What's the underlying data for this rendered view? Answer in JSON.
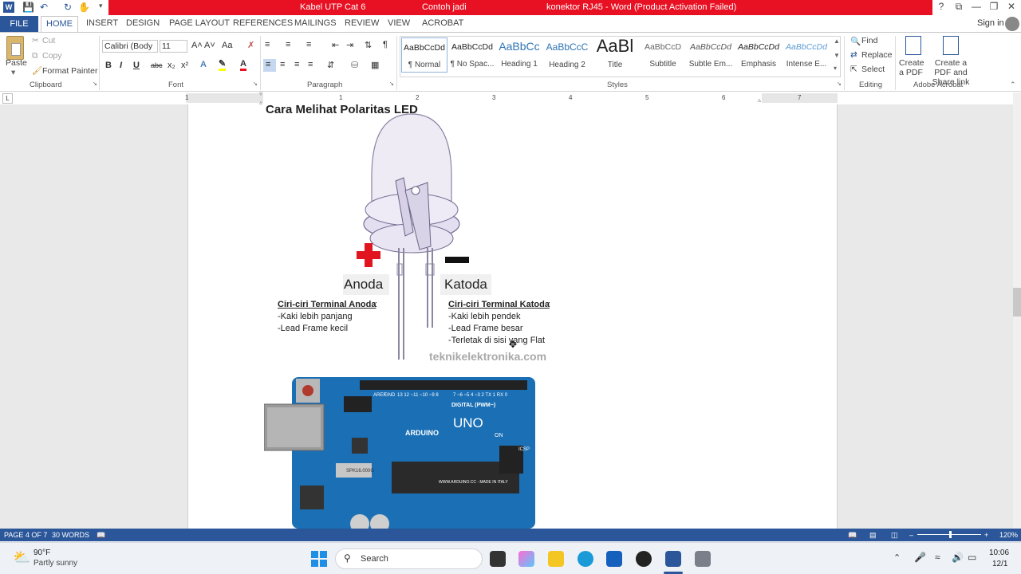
{
  "titlebar": {
    "doc_left": "Kabel UTP Cat 6",
    "doc_mid": "Contoh jadi",
    "doc_title": "konektor RJ45 -  Word (Product Activation Failed)",
    "help": "?",
    "sign_in": "Sign in"
  },
  "tabs": [
    "FILE",
    "HOME",
    "INSERT",
    "DESIGN",
    "PAGE LAYOUT",
    "REFERENCES",
    "MAILINGS",
    "REVIEW",
    "VIEW",
    "ACROBAT"
  ],
  "clipboard": {
    "paste": "Paste",
    "cut": "Cut",
    "copy": "Copy",
    "format_painter": "Format Painter",
    "label": "Clipboard"
  },
  "font": {
    "name": "Calibri (Body",
    "size": "11",
    "label": "Font",
    "grow": "A˄",
    "shrink": "A˅",
    "case": "Aa",
    "bold": "B",
    "italic": "I",
    "underline": "U",
    "strike": "abc",
    "sub": "x₂",
    "sup": "x²"
  },
  "paragraph": {
    "label": "Paragraph"
  },
  "styles": {
    "label": "Styles",
    "items": [
      {
        "sample": "AaBbCcDd",
        "name": "¶ Normal"
      },
      {
        "sample": "AaBbCcDd",
        "name": "¶ No Spac..."
      },
      {
        "sample": "AaBbCc",
        "name": "Heading 1"
      },
      {
        "sample": "AaBbCcC",
        "name": "Heading 2"
      },
      {
        "sample": "AaBl",
        "name": "Title"
      },
      {
        "sample": "AaBbCcD",
        "name": "Subtitle"
      },
      {
        "sample": "AaBbCcDd",
        "name": "Subtle Em..."
      },
      {
        "sample": "AaBbCcDd",
        "name": "Emphasis"
      },
      {
        "sample": "AaBbCcDd",
        "name": "Intense E..."
      }
    ]
  },
  "editing": {
    "find": "Find",
    "replace": "Replace",
    "select": "Select",
    "label": "Editing"
  },
  "acrobat": {
    "create_pdf": "Create a PDF",
    "create_share": "Create a PDF and Share link",
    "label": "Adobe Acrobat"
  },
  "ruler": {
    "numbers": [
      "1",
      "1",
      "2",
      "3",
      "4",
      "5",
      "6",
      "7"
    ],
    "corner": "L"
  },
  "document": {
    "heading": "Cara Melihat Polaritas LED",
    "anoda": "Anoda",
    "katoda": "Katoda",
    "anoda_title": "Ciri-ciri Terminal Anoda",
    "anoda_colon": ":",
    "anoda_items": [
      "-Kaki lebih panjang",
      "-Lead Frame kecil"
    ],
    "katoda_title": "Ciri-ciri Terminal Katoda",
    "katoda_colon": ":",
    "katoda_items": [
      "-Kaki lebih pendek",
      "-Lead Frame besar",
      "-Terletak di sisi yang Flat"
    ],
    "watermark": "teknikelektronika.com",
    "board_brand": "ARDUINO",
    "board_model": "UNO",
    "board_digital": "DIGITAL (PWM~)",
    "board_site": "WWW.ARDUINO.CC - MADE IN ITALY",
    "board_crystal": "SPK16.000G",
    "board_on": "ON",
    "board_aref": "AREF",
    "board_gnd": "GND",
    "board_pins": "13 12 ~11 ~10 ~9 8",
    "board_pins2": "7 ~6 ~5 4 ~3 2 TX 1 RX 0",
    "board_icsp": "ICSP"
  },
  "status": {
    "page": "PAGE 4 OF 7",
    "words": "30 WORDS",
    "zoom": "120%"
  },
  "taskbar": {
    "temp": "90°F",
    "weather": "Partly sunny",
    "search": "Search",
    "time": "10:06",
    "date": "12/1"
  },
  "colors": {
    "word_blue": "#2b579a",
    "title_red": "#e81123",
    "arduino_blue": "#1a6fb5"
  }
}
